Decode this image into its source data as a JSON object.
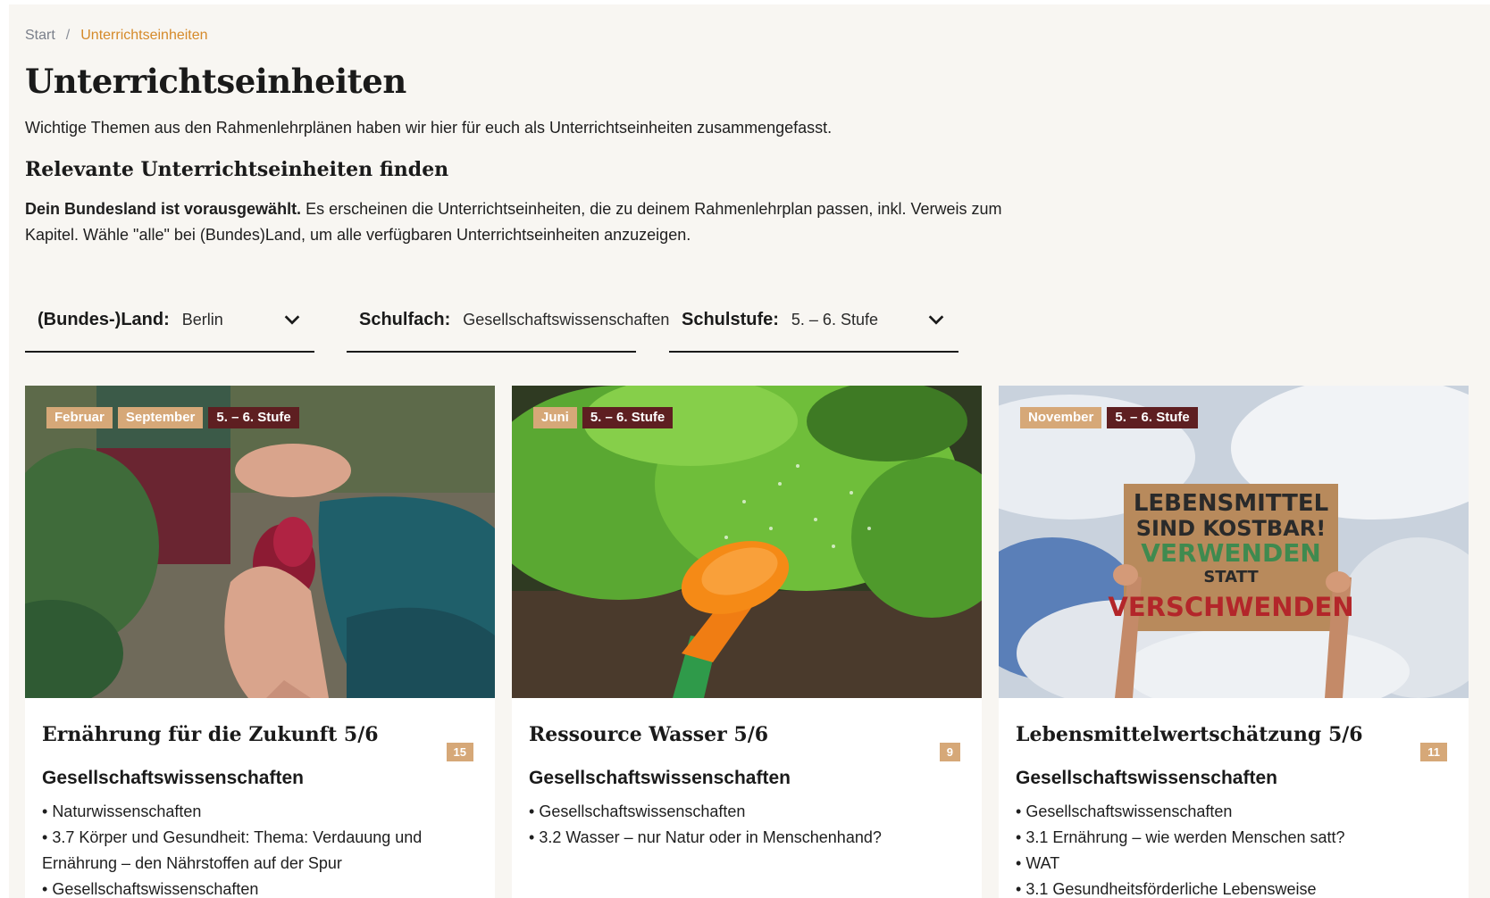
{
  "breadcrumb": {
    "home": "Start",
    "separator": "/",
    "current": "Unterrichtseinheiten"
  },
  "header": {
    "title": "Unterrichtseinheiten",
    "intro": "Wichtige Themen aus den Rahmenlehrplänen haben wir hier für euch als Unterrichtseinheiten zusammengefasst.",
    "subheading": "Relevante Unterrichtseinheiten finden",
    "notice_bold": "Dein Bundesland ist vorausgewählt.",
    "notice_text": " Es erscheinen die Unterrichtseinheiten, die zu deinem Rahmenlehrplan passen, inkl. Verweis zum Kapitel. Wähle \"alle\" bei (Bundes)Land, um alle verfügbaren Unterrichtseinheiten anzuzeigen."
  },
  "filters": {
    "state": {
      "label": "(Bundes-)Land:",
      "value": "Berlin",
      "icon": "chevron-down-icon"
    },
    "subject": {
      "label": "Schulfach:",
      "value": "Gesellschaftswissenschaften"
    },
    "level": {
      "label": "Schulstufe:",
      "value": "5. – 6. Stufe",
      "icon": "chevron-down-icon"
    }
  },
  "cards": [
    {
      "tags": [
        "Februar",
        "September"
      ],
      "level_tag": "5. – 6. Stufe",
      "title": "Ernährung für die Zukunft 5/6",
      "count": "15",
      "subject": "Gesellschaftswissenschaften",
      "items": [
        "Naturwissenschaften",
        "3.7 Körper und Gesundheit: Thema: Verdauung und Ernährung – den Nährstoffen auf der Spur",
        "Gesellschaftswissenschaften"
      ],
      "image": "hands-peeling-beetroot"
    },
    {
      "tags": [
        "Juni"
      ],
      "level_tag": "5. – 6. Stufe",
      "title": "Ressource Wasser 5/6",
      "count": "9",
      "subject": "Gesellschaftswissenschaften",
      "items": [
        "Gesellschaftswissenschaften",
        "3.2 Wasser – nur Natur oder in Menschenhand?"
      ],
      "image": "watering-can-lettuce"
    },
    {
      "tags": [
        "November"
      ],
      "level_tag": "5. – 6. Stufe",
      "title": "Lebensmittelwertschätzung 5/6",
      "count": "11",
      "subject": "Gesellschaftswissenschaften",
      "items": [
        "Gesellschaftswissenschaften",
        "3.1 Ernährung – wie werden Menschen satt?",
        "WAT",
        "3.1 Gesundheitsförderliche Lebensweise"
      ],
      "image": "protest-sign",
      "sign_lines": [
        "LEBENSMITTEL",
        "SIND KOSTBAR!",
        "VERWENDEN",
        "STATT",
        "VERSCHWENDEN"
      ]
    }
  ],
  "colors": {
    "accent": "#d58a2a",
    "tag_month": "#d6a878",
    "tag_level": "#5e1f21",
    "page_bg": "#f8f6f2"
  }
}
